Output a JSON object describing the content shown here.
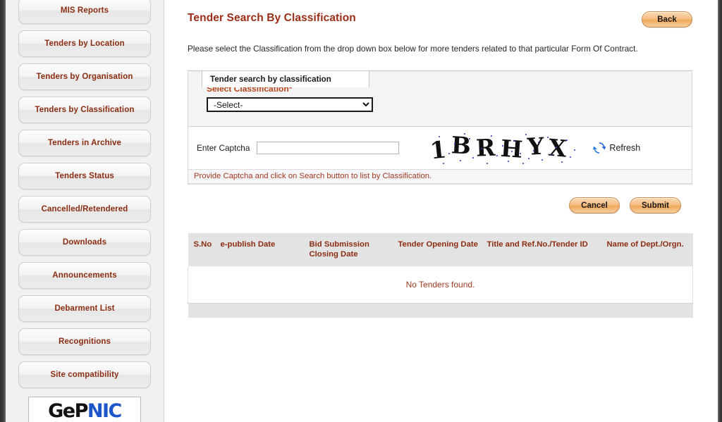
{
  "sidebar": {
    "items": [
      {
        "label": "MIS Reports",
        "name": "sidebar-item-mis-reports"
      },
      {
        "label": "Tenders by Location",
        "name": "sidebar-item-tenders-by-location"
      },
      {
        "label": "Tenders by Organisation",
        "name": "sidebar-item-tenders-by-organisation"
      },
      {
        "label": "Tenders by Classification",
        "name": "sidebar-item-tenders-by-classification"
      },
      {
        "label": "Tenders in Archive",
        "name": "sidebar-item-tenders-in-archive"
      },
      {
        "label": "Tenders Status",
        "name": "sidebar-item-tenders-status"
      },
      {
        "label": "Cancelled/Retendered",
        "name": "sidebar-item-cancelled-retendered"
      },
      {
        "label": "Downloads",
        "name": "sidebar-item-downloads"
      },
      {
        "label": "Announcements",
        "name": "sidebar-item-announcements"
      },
      {
        "label": "Debarment List",
        "name": "sidebar-item-debarment-list"
      },
      {
        "label": "Recognitions",
        "name": "sidebar-item-recognitions"
      },
      {
        "label": "Site compatibility",
        "name": "sidebar-item-site-compatibility"
      }
    ],
    "logo": {
      "part1": "GeP",
      "part2": "NIC"
    }
  },
  "header": {
    "title": "Tender Search By Classification",
    "back_label": "Back"
  },
  "intro": "Please select the Classification from the drop down box below for more tenders related to that particular Form Of Contract.",
  "panel": {
    "tab_label": "Tender search by classification",
    "classification": {
      "label": "Select Classification",
      "required_mark": "*",
      "selected": "-Select-",
      "options": [
        "-Select-"
      ]
    },
    "captcha": {
      "label": "Enter Captcha",
      "input_value": "",
      "input_placeholder": "",
      "image_text": "1BRHYX",
      "refresh_label": "Refresh"
    },
    "hint": "Provide Captcha and click on Search button to list by Classification."
  },
  "actions": {
    "cancel_label": "Cancel",
    "submit_label": "Submit"
  },
  "results": {
    "columns": [
      "S.No",
      "e-publish Date",
      "Bid Submission Closing Date",
      "Tender Opening Date",
      "Title and Ref.No./Tender ID",
      "Name of Dept./Orgn."
    ],
    "empty_message": "No Tenders found.",
    "rows": []
  },
  "colors": {
    "accent_red": "#9b2d15",
    "link_red": "#8c2d12",
    "label_orange": "#b54518",
    "button_orange": "#f0a95f",
    "captcha_noise_blue": "#2a36b8"
  }
}
